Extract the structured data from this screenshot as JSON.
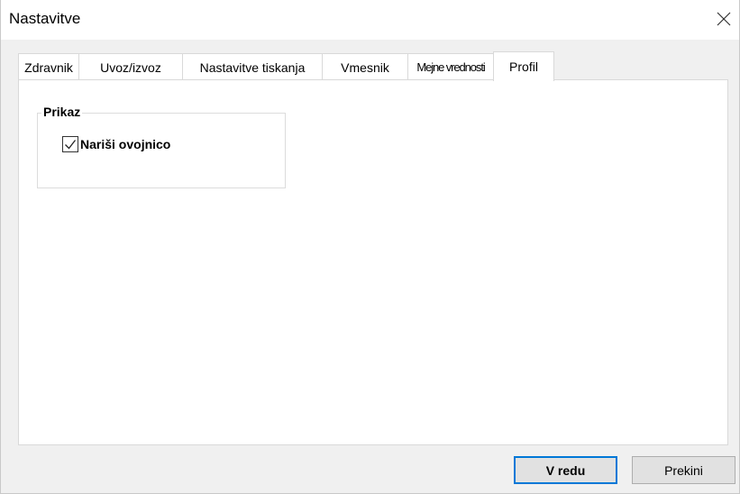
{
  "window": {
    "title": "Nastavitve"
  },
  "tabs": [
    {
      "label": "Zdravnik"
    },
    {
      "label": "Uvoz/izvoz"
    },
    {
      "label": "Nastavitve tiskanja"
    },
    {
      "label": "Vmesnik"
    },
    {
      "label": "Mejne vrednosti"
    },
    {
      "label": "Profil",
      "active": true
    }
  ],
  "profile": {
    "group_title": "Prikaz",
    "draw_envelope": {
      "label": "Nariši ovojnico",
      "checked": true
    }
  },
  "buttons": {
    "ok_label": "V redu",
    "cancel_label": "Prekini"
  },
  "icons": {
    "close": "close-icon",
    "check": "checkmark-icon"
  },
  "colors": {
    "focus_border": "#0078d7",
    "panel": "#ffffff",
    "dialog": "#f0f0f0"
  }
}
